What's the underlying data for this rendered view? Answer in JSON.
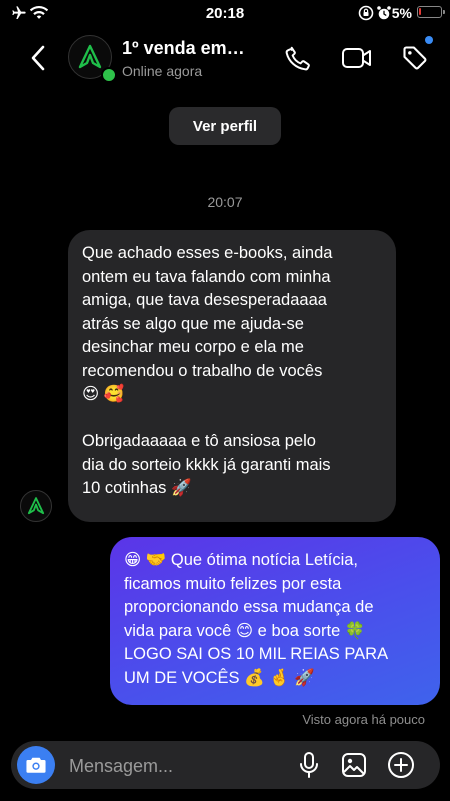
{
  "status_bar": {
    "time": "20:18",
    "battery_percent": 5,
    "battery_label": "5%",
    "icons": [
      "airplane-mode-icon",
      "wifi-icon",
      "screen-rotation-lock-icon",
      "alarm-icon",
      "battery-icon"
    ]
  },
  "header": {
    "contact_name": "1º venda em…",
    "contact_status": "Online agora",
    "actions": [
      "phone-icon",
      "video-camera-icon",
      "tag-icon"
    ]
  },
  "chat": {
    "ver_perfil_label": "Ver perfil",
    "timestamp": "20:07",
    "incoming_message": "Que achado esses e-books, ainda\nontem eu tava falando com minha\namiga, que tava desesperadaaaa\natrás se algo que me ajuda-se\ndesinchar meu corpo e ela me\nrecomendou o trabalho de vocês\n😍 🥰\n\nObrigadaaaaa e tô ansiosa pelo\ndia do sorteio kkkk já garanti mais\n10 cotinhas 🚀",
    "outgoing_message": "😁 🤝 Que ótima notícia Letícia,\nficamos muito felizes por esta\nproporcionando essa mudança de\nvida para você 😊 e boa sorte 🍀\nLOGO SAI OS 10 MIL REIAS PARA\nUM DE VOCÊS 💰 🤞 🚀",
    "seen_status": "Visto agora há pouco"
  },
  "composer": {
    "placeholder": "Mensagem..."
  },
  "colors": {
    "background": "#000000",
    "incoming_bubble": "#262628",
    "outgoing_gradient_start": "#5b35e8",
    "outgoing_gradient_end": "#3f63ec",
    "camera_button": "#3b7ff2",
    "online_dot": "#2ec24a",
    "brand_logo": "#1fbf4a",
    "battery_low": "#e53935"
  }
}
